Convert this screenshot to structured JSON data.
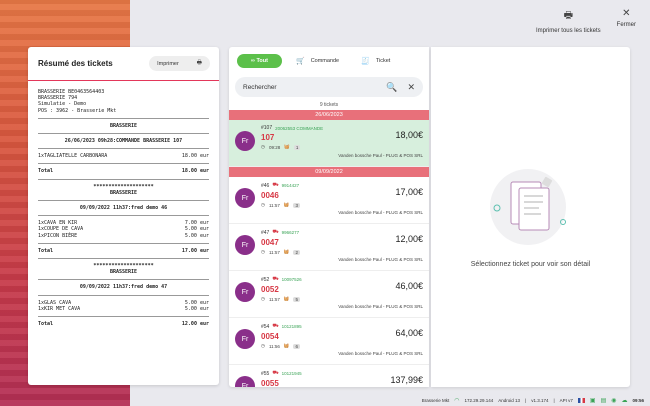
{
  "header": {
    "print_all_label": "Imprimer tous les tickets",
    "close_label": "Fermer"
  },
  "receipt_panel": {
    "title": "Résumé des tickets",
    "print_label": "Imprimer",
    "lines": {
      "l1": "BRASSERIE BE0463564403",
      "l2": "BRASSERIE 794",
      "l3": "Simulatie - Demo",
      "l4": "POS : 3962 - Brasserie Mkt",
      "s1_name": "BRASSERIE",
      "s1_head": "26/06/2023 09h28:COMMANDE BRASSERIE 107",
      "s1_item1": "1xTAGLIATELLE CARBONARA",
      "s1_item1_price": "18.00 eur",
      "s1_total": "Total",
      "s1_total_val": "18.00 eur",
      "stars1": "********************",
      "s2_name": "BRASSERIE",
      "s2_head": "09/09/2022 11h37:fred demo 46",
      "s2_item1": "1xCAVA EN KIR",
      "s2_item1_price": "7.00 eur",
      "s2_item2": "1xCOUPE DE CAVA",
      "s2_item2_price": "5.00 eur",
      "s2_item3": "1xPICON BIÈRE",
      "s2_item3_price": "5.00 eur",
      "s2_total": "Total",
      "s2_total_val": "17.00 eur",
      "stars2": "********************",
      "s3_name": "BRASSERIE",
      "s3_head": "09/09/2022 11h37:fred demo 47",
      "s3_item1": "1xGLAS CAVA",
      "s3_item1_price": "5.00 eur",
      "s3_item2": "1xKIR MET CAVA",
      "s3_item2_price": "5.00 eur",
      "s3_total": "Total",
      "s3_total_val": "12.00 eur"
    }
  },
  "tabs": {
    "all": "Tout",
    "order": "Commande",
    "ticket": "Ticket"
  },
  "search": {
    "placeholder": "Rechercher"
  },
  "count": "9 tickets",
  "dates": {
    "d1": "26/06/2023",
    "d2": "09/09/2022"
  },
  "tickets": [
    {
      "num": "#107",
      "code": "20062553 COMMANDE",
      "big": "107",
      "time": "09:28",
      "qty": "1",
      "seller": "Vanden bossche Paul - PLUG & POS SRL",
      "amount": "18,00€",
      "avatar": "Fr"
    },
    {
      "num": "#46",
      "code": "9914427",
      "big": "0046",
      "time": "11:57",
      "qty": "3",
      "seller": "Vanden bossche Paul - PLUG & POS SRL",
      "amount": "17,00€",
      "avatar": "Fr"
    },
    {
      "num": "#47",
      "code": "9966277",
      "big": "0047",
      "time": "11:57",
      "qty": "2",
      "seller": "Vanden bossche Paul - PLUG & POS SRL",
      "amount": "12,00€",
      "avatar": "Fr"
    },
    {
      "num": "#52",
      "code": "10097526",
      "big": "0052",
      "time": "11:57",
      "qty": "5",
      "seller": "Vanden bossche Paul - PLUG & POS SRL",
      "amount": "46,00€",
      "avatar": "Fr"
    },
    {
      "num": "#54",
      "code": "10121895",
      "big": "0054",
      "time": "11:56",
      "qty": "6",
      "seller": "Vanden bossche Paul - PLUG & POS SRL",
      "amount": "64,00€",
      "avatar": "Fr"
    },
    {
      "num": "#55",
      "code": "10121945",
      "big": "0055",
      "time": "",
      "qty": "",
      "seller": "",
      "amount": "137,99€",
      "avatar": "Fr"
    }
  ],
  "right_panel": {
    "empty_text": "Sélectionnez ticket pour voir son détail"
  },
  "status": {
    "name": "Brasserie Mkt",
    "ip": "172.29.29.144",
    "os": "Android 13",
    "ver": "v1.3.174",
    "api": "API v7",
    "time": "09:56"
  },
  "colors": {
    "accent_green": "#5cc04a",
    "accent_red": "#d73845",
    "avatar": "#8a2f8a"
  }
}
